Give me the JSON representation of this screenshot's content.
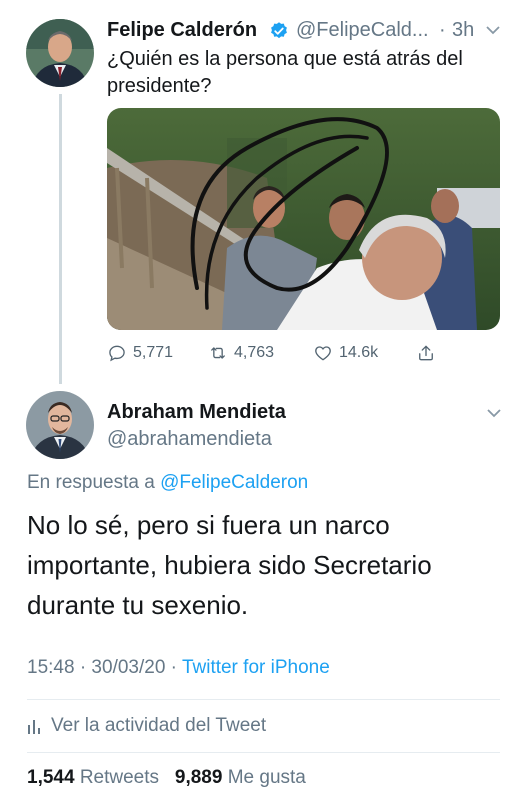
{
  "original_tweet": {
    "author_name": "Felipe Calderón",
    "handle": "@FelipeCald...",
    "separator": "·",
    "time": "3h",
    "text": "¿Quién es la persona que está atrás del presidente?",
    "verified_icon": "verified-badge-icon",
    "actions": {
      "replies": "5,771",
      "retweets": "4,763",
      "likes": "14.6k"
    }
  },
  "reply_tweet": {
    "author_name": "Abraham Mendieta",
    "handle": "@abrahamendieta",
    "replying_prefix": "En respuesta a",
    "replying_to": "@FelipeCalderon",
    "text": "No lo sé, pero si fuera un narco importante, hubiera sido Secretario durante tu sexenio.",
    "timestamp": "15:48 · 30/03/20 ·",
    "source": "Twitter for iPhone",
    "activity_label": "Ver la actividad del Tweet",
    "retweet_count": "1,544",
    "retweet_label": "Retweets",
    "like_count": "9,889",
    "like_label": "Me gusta"
  },
  "colors": {
    "link_blue": "#1da1f2",
    "verified_blue": "#1da1f2",
    "muted_gray": "#657786",
    "text_dark": "#14171a",
    "divider": "#e6ecf0",
    "thread_line": "#cfd9de"
  }
}
